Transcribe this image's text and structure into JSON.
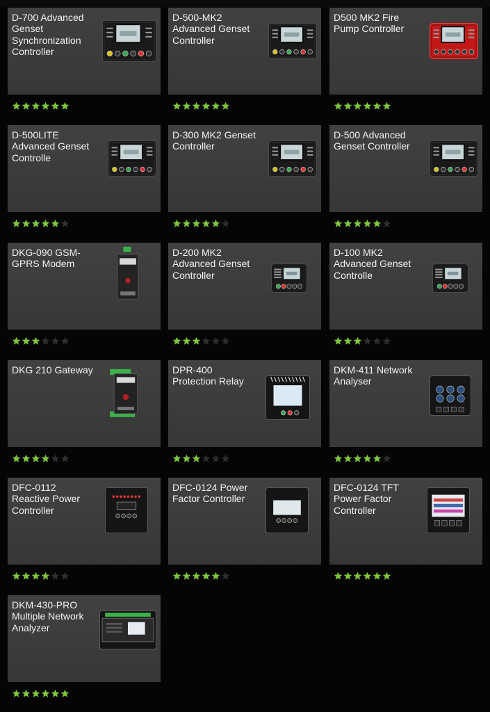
{
  "colors": {
    "star_on": "#7ec63c",
    "star_off": "#2e2e2e",
    "panel": "#3a3a3a",
    "background": "#050505"
  },
  "products": [
    {
      "title": "D-700 Advanced Genset Synchronization Controller",
      "rating": 6,
      "icon": "genset-controller-icon",
      "variant": "d700"
    },
    {
      "title": "D-500-MK2 Advanced Genset Controller",
      "rating": 6,
      "icon": "genset-controller-icon",
      "variant": "d500"
    },
    {
      "title": "D500 MK2 Fire Pump Controller",
      "rating": 6,
      "icon": "fire-pump-controller-icon",
      "variant": "red"
    },
    {
      "title": "D-500LITE Advanced Genset Controlle",
      "rating": 5,
      "icon": "genset-controller-icon",
      "variant": "d500"
    },
    {
      "title": "D-300 MK2 Genset Controller",
      "rating": 5,
      "icon": "genset-controller-icon",
      "variant": "d300"
    },
    {
      "title": "D-500 Advanced Genset Controller",
      "rating": 5,
      "icon": "genset-controller-icon",
      "variant": "d500"
    },
    {
      "title": "DKG-090 GSM-GPRS Modem",
      "rating": 3,
      "icon": "gsm-modem-icon",
      "variant": "din-small"
    },
    {
      "title": "D-200 MK2 Advanced Genset Controller",
      "rating": 3,
      "icon": "genset-controller-icon",
      "variant": "d200"
    },
    {
      "title": "D-100 MK2 Advanced Genset Controlle",
      "rating": 3,
      "icon": "genset-controller-icon",
      "variant": "d200"
    },
    {
      "title": "DKG 210 Gateway",
      "rating": 4,
      "icon": "gateway-icon",
      "variant": "din-green"
    },
    {
      "title": "DPR-400 Protection Relay",
      "rating": 3,
      "icon": "protection-relay-icon",
      "variant": "dpr"
    },
    {
      "title": "DKM-411 Network Analyser",
      "rating": 5,
      "icon": "network-analyser-icon",
      "variant": "dkm"
    },
    {
      "title": "DFC-0112 Reactive Power Controller",
      "rating": 4,
      "icon": "power-controller-icon",
      "variant": "dfc"
    },
    {
      "title": "DFC-0124 Power Factor Controller",
      "rating": 5,
      "icon": "power-factor-controller-icon",
      "variant": "dfc-lcd"
    },
    {
      "title": "DFC-0124 TFT Power Factor Controller",
      "rating": 6,
      "icon": "power-factor-controller-icon",
      "variant": "tft"
    },
    {
      "title": "DKM-430-PRO Multiple Network Analyzer",
      "rating": 6,
      "icon": "network-analyzer-icon",
      "variant": "din-wide"
    }
  ]
}
